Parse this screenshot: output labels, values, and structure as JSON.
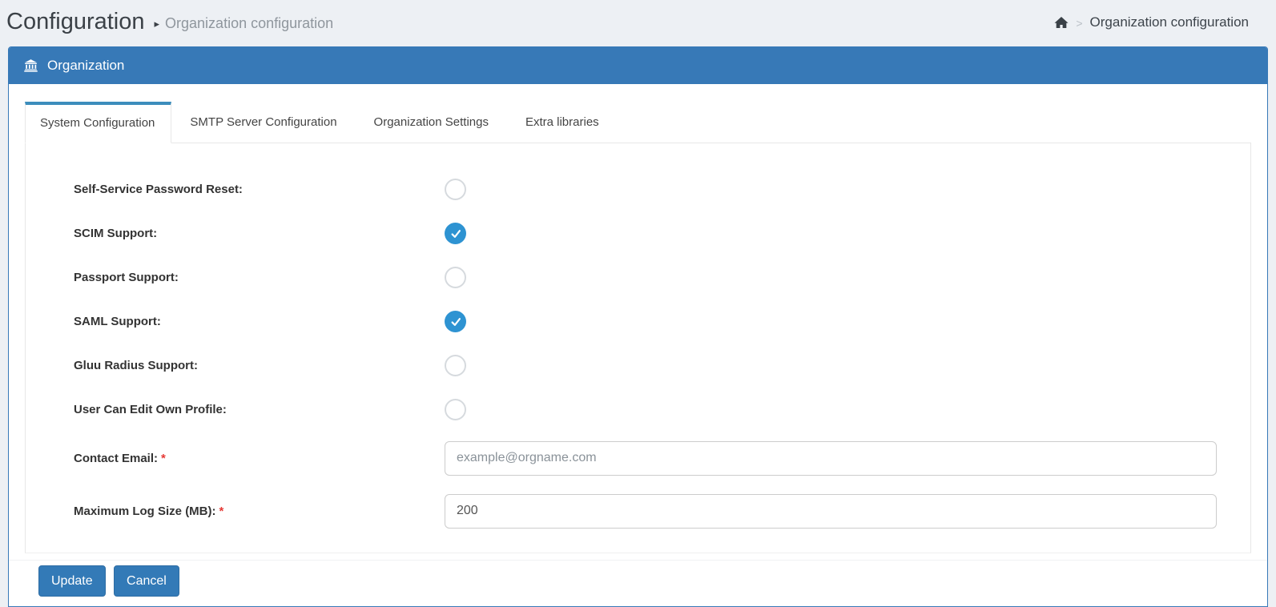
{
  "header": {
    "title": "Configuration",
    "title_separator": "▸",
    "subtitle": "Organization configuration",
    "breadcrumb": {
      "separator": ">",
      "current": "Organization configuration"
    }
  },
  "panel": {
    "title": "Organization"
  },
  "tabs": [
    {
      "label": "System Configuration",
      "active": true
    },
    {
      "label": "SMTP Server Configuration",
      "active": false
    },
    {
      "label": "Organization Settings",
      "active": false
    },
    {
      "label": "Extra libraries",
      "active": false
    }
  ],
  "form": {
    "required_mark": "*",
    "toggles": [
      {
        "label": "Self-Service Password Reset:",
        "checked": false
      },
      {
        "label": "SCIM Support:",
        "checked": true
      },
      {
        "label": "Passport Support:",
        "checked": false
      },
      {
        "label": "SAML Support:",
        "checked": true
      },
      {
        "label": "Gluu Radius Support:",
        "checked": false
      },
      {
        "label": "User Can Edit Own Profile:",
        "checked": false
      }
    ],
    "inputs": [
      {
        "label": "Contact Email:",
        "required": true,
        "value": "",
        "placeholder": "example@orgname.com"
      },
      {
        "label": "Maximum Log Size (MB):",
        "required": true,
        "value": "200",
        "placeholder": ""
      }
    ]
  },
  "footer": {
    "update_label": "Update",
    "cancel_label": "Cancel"
  },
  "colors": {
    "page_bg": "#edf0f4",
    "panel_blue": "#3779b7",
    "active_tab_bar": "#3c8dbc",
    "toggle_checked_blue": "#2e93d2",
    "button_blue": "#337ab7",
    "button_border": "#2e6da4",
    "required_red": "#e53935"
  }
}
